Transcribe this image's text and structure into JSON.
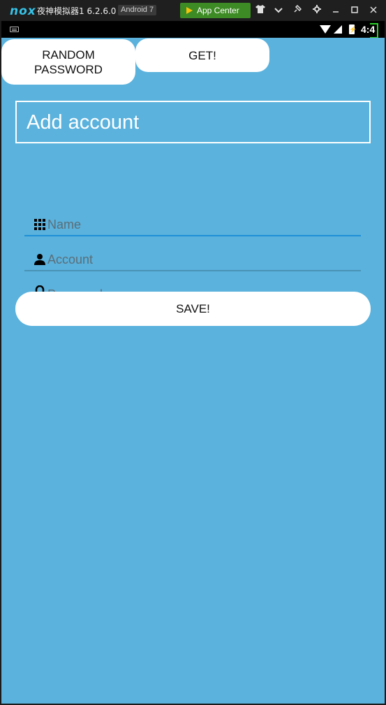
{
  "emulator": {
    "logo": "nox",
    "title": "夜神模拟器1 6.2.6.0",
    "android_badge": "Android 7",
    "app_center": "App Center",
    "icons": [
      "shirt-icon",
      "chevron-down-icon",
      "pin-icon",
      "gear-icon",
      "minimize-icon",
      "maximize-icon",
      "close-icon"
    ]
  },
  "status_bar": {
    "time": "4:4",
    "icons": [
      "keyboard-icon",
      "wifi-icon",
      "signal-icon",
      "battery-charging-icon"
    ]
  },
  "app": {
    "background_color": "#5ab2dd",
    "random_password_button": "RANDOM PASSWORD",
    "get_button": "GET!",
    "title": "Add account",
    "fields": {
      "name": {
        "placeholder": "Name",
        "icon": "grid-icon",
        "value": ""
      },
      "account": {
        "placeholder": "Account",
        "icon": "person-icon",
        "value": ""
      },
      "password": {
        "placeholder": "Password",
        "icon": "lock-icon",
        "value": ""
      }
    },
    "save_button": "SAVE!",
    "accent_color": "#1f8fd6"
  }
}
